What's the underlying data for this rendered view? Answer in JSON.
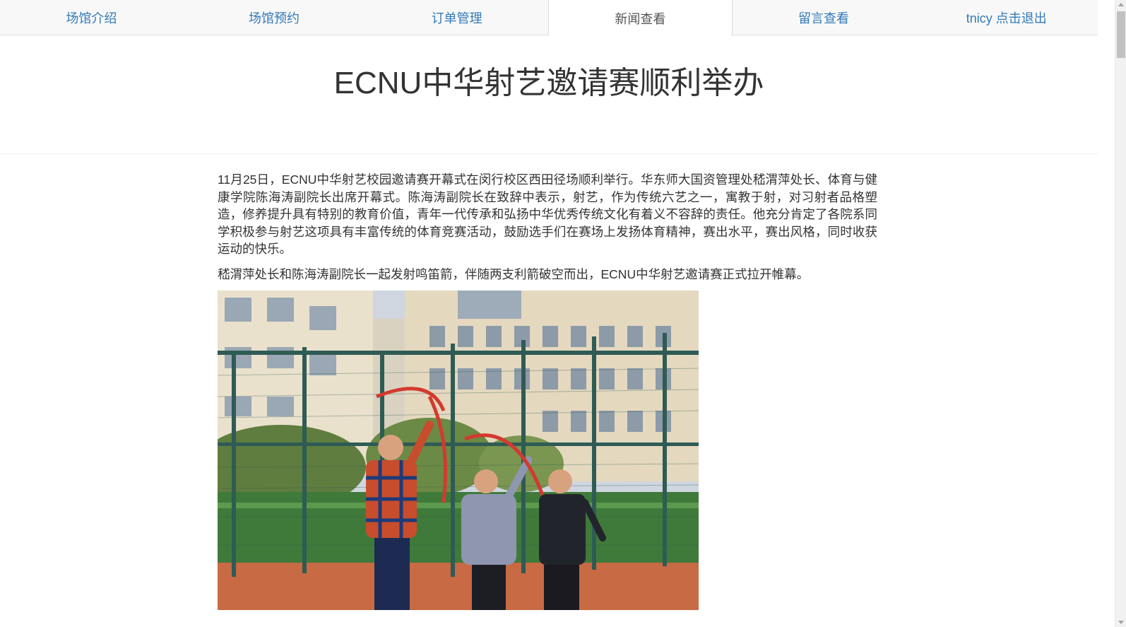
{
  "nav": {
    "tabs": [
      {
        "label": "场馆介绍"
      },
      {
        "label": "场馆预约"
      },
      {
        "label": "订单管理"
      },
      {
        "label": "新闻查看",
        "active": true
      },
      {
        "label": "留言查看"
      },
      {
        "label": "tnicy 点击退出"
      }
    ]
  },
  "article": {
    "title": "ECNU中华射艺邀请赛顺利举办",
    "paragraphs": [
      "11月25日，ECNU中华射艺校园邀请赛开幕式在闵行校区西田径场顺利举行。华东师大国资管理处嵇渭萍处长、体育与健康学院陈海涛副院长出席开幕式。陈海涛副院长在致辞中表示，射艺，作为传统六艺之一，寓教于射，对习射者品格塑造，修养提升具有特别的教育价值，青年一代传承和弘扬中华优秀传统文化有着义不容辞的责任。他充分肯定了各院系同学积极参与射艺这项具有丰富传统的体育竞赛活动，鼓励选手们在赛场上发扬体育精神，赛出水平，赛出风格，同时收获运动的快乐。",
      "嵇渭萍处长和陈海涛副院长一起发射鸣笛箭，伴随两支利箭破空而出，ECNU中华射艺邀请赛正式拉开帷幕。"
    ]
  },
  "colors": {
    "link": "#337ab7",
    "active_tab_text": "#555555",
    "nav_bg": "#f8f8f8",
    "text": "#333333"
  }
}
